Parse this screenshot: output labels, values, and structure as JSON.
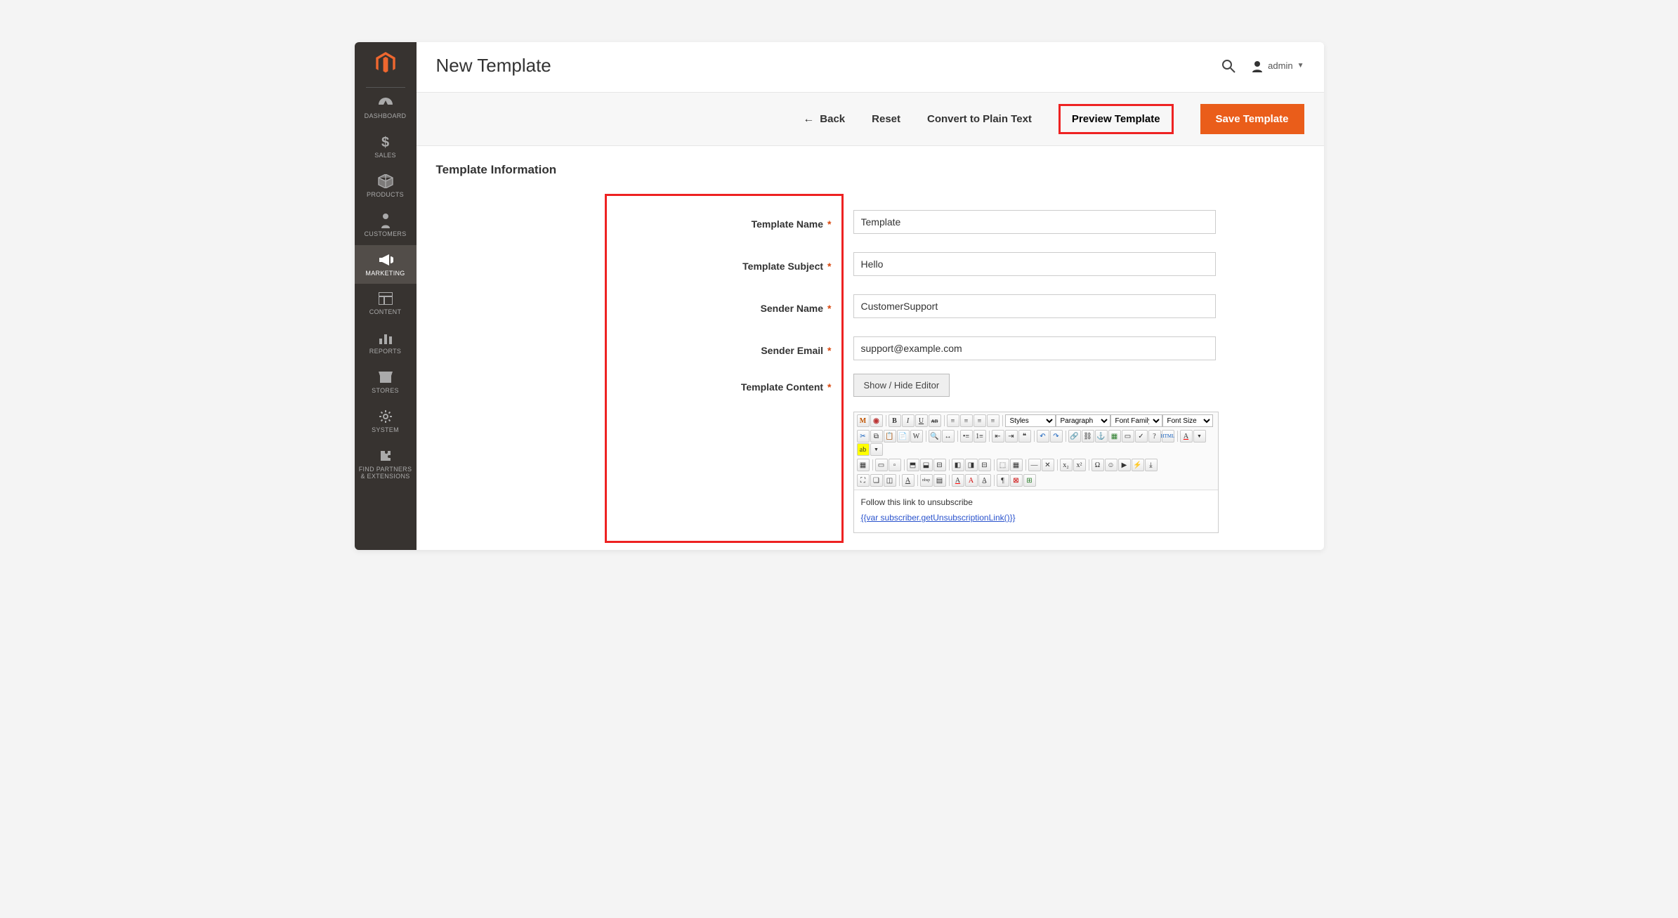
{
  "sidebar": {
    "items": [
      {
        "label": "DASHBOARD",
        "icon": "dashboard"
      },
      {
        "label": "SALES",
        "icon": "dollar"
      },
      {
        "label": "PRODUCTS",
        "icon": "box"
      },
      {
        "label": "CUSTOMERS",
        "icon": "person"
      },
      {
        "label": "MARKETING",
        "icon": "megaphone",
        "active": true
      },
      {
        "label": "CONTENT",
        "icon": "layout"
      },
      {
        "label": "REPORTS",
        "icon": "bars"
      },
      {
        "label": "STORES",
        "icon": "storefront"
      },
      {
        "label": "SYSTEM",
        "icon": "gear"
      },
      {
        "label": "FIND PARTNERS & EXTENSIONS",
        "icon": "puzzle"
      }
    ]
  },
  "header": {
    "page_title": "New Template",
    "user_label": "admin"
  },
  "actions": {
    "back": "Back",
    "reset": "Reset",
    "convert": "Convert to Plain Text",
    "preview": "Preview Template",
    "save": "Save Template"
  },
  "section_title": "Template Information",
  "form": {
    "labels": {
      "name": "Template Name",
      "subject": "Template Subject",
      "sender_name": "Sender Name",
      "sender_email": "Sender Email",
      "content": "Template Content"
    },
    "values": {
      "name": "Template",
      "subject": "Hello",
      "sender_name": "CustomerSupport",
      "sender_email": "support@example.com"
    },
    "show_hide": "Show / Hide Editor"
  },
  "editor_toolbar": {
    "styles": "Styles",
    "paragraph": "Paragraph",
    "font_family": "Font Family",
    "font_size": "Font Size"
  },
  "editor_body": {
    "text": "Follow this link to unsubscribe",
    "link": "{{var subscriber.getUnsubscriptionLink()}}"
  }
}
